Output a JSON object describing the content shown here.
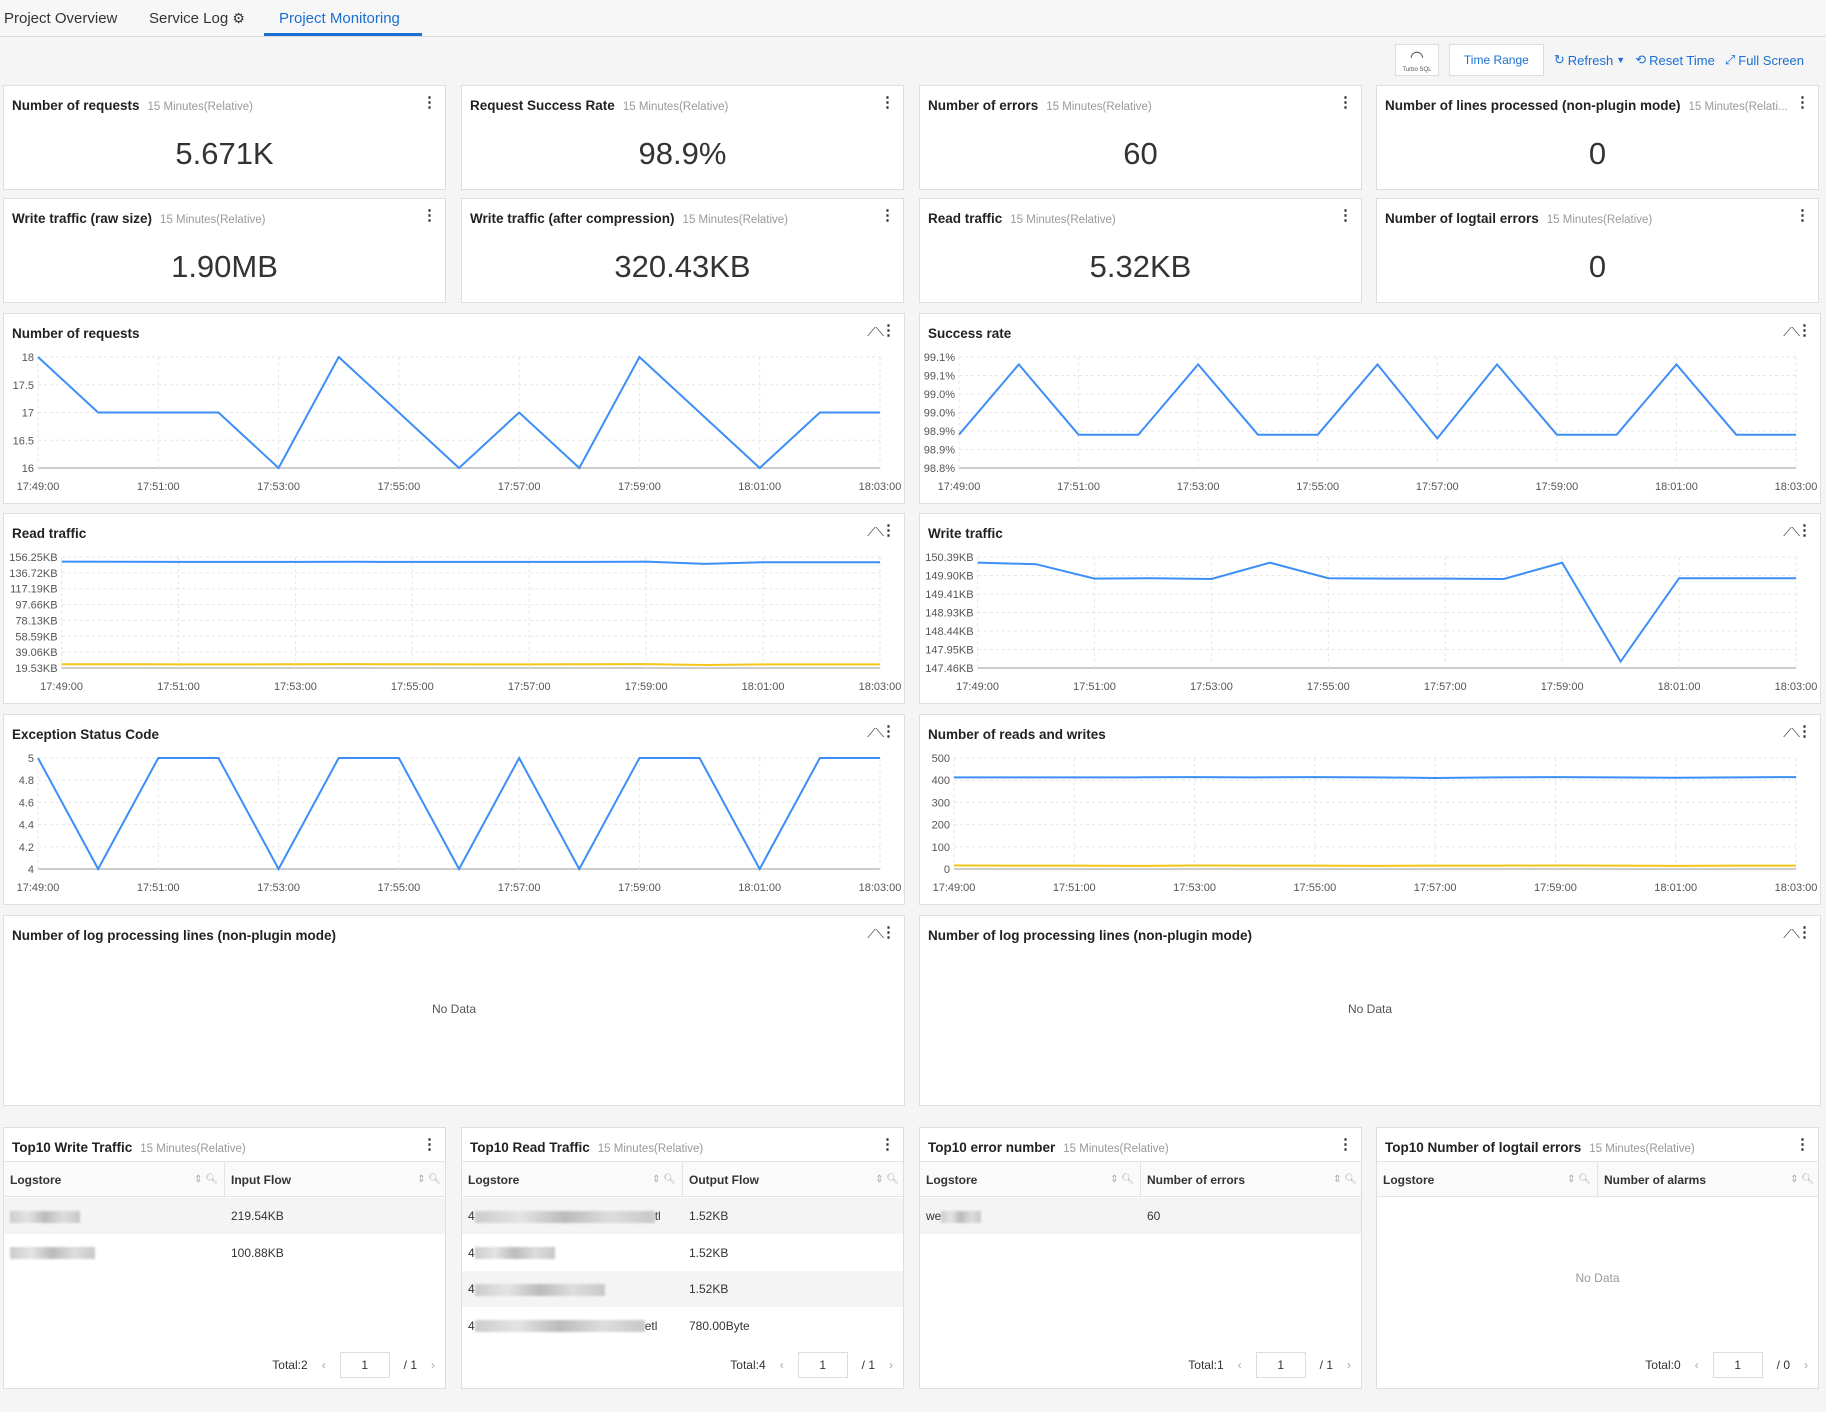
{
  "tabs": [
    {
      "label": "Project Overview"
    },
    {
      "label": "Service Log"
    },
    {
      "label": "Project Monitoring",
      "active": true
    }
  ],
  "toolbar": {
    "turbo_label": "Turbo SQL",
    "time_range": "Time Range",
    "refresh": "Refresh",
    "reset_time": "Reset Time",
    "full_screen": "Full Screen"
  },
  "colors": {
    "accent": "#1b6fd1",
    "series_blue": "#3d8ef7",
    "series_yellow": "#f5c518"
  },
  "stats": [
    {
      "title": "Number of requests",
      "range": "15 Minutes(Relative)",
      "value": "5.671K"
    },
    {
      "title": "Request Success Rate",
      "range": "15 Minutes(Relative)",
      "value": "98.9%"
    },
    {
      "title": "Number of errors",
      "range": "15 Minutes(Relative)",
      "value": "60"
    },
    {
      "title": "Number of lines processed (non-plugin mode)",
      "range": "15 Minutes(Relati...",
      "value": "0"
    },
    {
      "title": "Write traffic (raw size)",
      "range": "15 Minutes(Relative)",
      "value": "1.90MB"
    },
    {
      "title": "Write traffic (after compression)",
      "range": "15 Minutes(Relative)",
      "value": "320.43KB"
    },
    {
      "title": "Read traffic",
      "range": "15 Minutes(Relative)",
      "value": "5.32KB"
    },
    {
      "title": "Number of logtail errors",
      "range": "15 Minutes(Relative)",
      "value": "0"
    }
  ],
  "chart_data": [
    {
      "type": "line",
      "title": "Number of requests",
      "x": [
        "17:49:00",
        "17:50:00",
        "17:51:00",
        "17:52:00",
        "17:53:00",
        "17:54:00",
        "17:55:00",
        "17:56:00",
        "17:57:00",
        "17:58:00",
        "17:59:00",
        "18:00:00",
        "18:01:00",
        "18:02:00",
        "18:03:00"
      ],
      "xticks": [
        "17:49:00",
        "17:51:00",
        "17:53:00",
        "17:55:00",
        "17:57:00",
        "17:59:00",
        "18:01:00",
        "18:03:00"
      ],
      "ylim": [
        16,
        18
      ],
      "yticks": [
        "16",
        "16.5",
        "17",
        "17.5",
        "18"
      ],
      "grid": true,
      "series": [
        {
          "color": "#3d8ef7",
          "values": [
            18,
            17,
            17,
            17,
            16,
            18,
            17,
            16,
            17,
            16,
            18,
            17,
            16,
            17,
            17
          ]
        }
      ]
    },
    {
      "type": "line",
      "title": "Success rate",
      "x": [
        "17:49:00",
        "17:50:00",
        "17:51:00",
        "17:52:00",
        "17:53:00",
        "17:54:00",
        "17:55:00",
        "17:56:00",
        "17:57:00",
        "17:58:00",
        "17:59:00",
        "18:00:00",
        "18:01:00",
        "18:02:00",
        "18:03:00"
      ],
      "xticks": [
        "17:49:00",
        "17:51:00",
        "17:53:00",
        "17:55:00",
        "17:57:00",
        "17:59:00",
        "18:01:00",
        "18:03:00"
      ],
      "ylim": [
        98.8,
        99.1
      ],
      "yticks": [
        "98.8%",
        "98.9%",
        "98.9%",
        "99.0%",
        "99.0%",
        "99.1%",
        "99.1%"
      ],
      "grid": true,
      "series": [
        {
          "color": "#3d8ef7",
          "values": [
            98.89,
            99.08,
            98.89,
            98.89,
            99.08,
            98.89,
            98.89,
            99.08,
            98.88,
            99.08,
            98.89,
            98.89,
            99.08,
            98.89,
            98.89
          ]
        }
      ]
    },
    {
      "type": "line",
      "title": "Read traffic",
      "x": [
        "17:49:00",
        "17:50:00",
        "17:51:00",
        "17:52:00",
        "17:53:00",
        "17:54:00",
        "17:55:00",
        "17:56:00",
        "17:57:00",
        "17:58:00",
        "17:59:00",
        "18:00:00",
        "18:01:00",
        "18:02:00",
        "18:03:00"
      ],
      "xticks": [
        "17:49:00",
        "17:51:00",
        "17:53:00",
        "17:55:00",
        "17:57:00",
        "17:59:00",
        "18:01:00",
        "18:03:00"
      ],
      "ylim": [
        19.53,
        156.25
      ],
      "yticks": [
        "19.53KB",
        "39.06KB",
        "58.59KB",
        "78.13KB",
        "97.66KB",
        "117.19KB",
        "136.72KB",
        "156.25KB"
      ],
      "grid": true,
      "series": [
        {
          "color": "#3d8ef7",
          "values": [
            150.5,
            150.4,
            150.2,
            150.2,
            150.2,
            150.4,
            150.2,
            150.2,
            150.2,
            150.2,
            150.5,
            147.8,
            149.8,
            149.8,
            149.8
          ]
        },
        {
          "color": "#f5c518",
          "values": [
            24.1,
            24.1,
            24.0,
            24.0,
            24.1,
            24.3,
            24.1,
            24.0,
            24.0,
            24.1,
            24.3,
            23.2,
            24.0,
            24.0,
            24.0
          ]
        }
      ]
    },
    {
      "type": "line",
      "title": "Write traffic",
      "x": [
        "17:49:00",
        "17:50:00",
        "17:51:00",
        "17:52:00",
        "17:53:00",
        "17:54:00",
        "17:55:00",
        "17:56:00",
        "17:57:00",
        "17:58:00",
        "17:59:00",
        "18:00:00",
        "18:01:00",
        "18:02:00",
        "18:03:00"
      ],
      "xticks": [
        "17:49:00",
        "17:51:00",
        "17:53:00",
        "17:55:00",
        "17:57:00",
        "17:59:00",
        "18:01:00",
        "18:03:00"
      ],
      "ylim": [
        147.46,
        150.39
      ],
      "yticks": [
        "147.46KB",
        "147.95KB",
        "148.44KB",
        "148.93KB",
        "149.41KB",
        "149.90KB",
        "150.39KB"
      ],
      "grid": true,
      "series": [
        {
          "color": "#3d8ef7",
          "values": [
            150.24,
            150.2,
            149.82,
            149.83,
            149.81,
            150.24,
            149.83,
            149.82,
            149.82,
            149.81,
            150.24,
            147.63,
            149.83,
            149.83,
            149.83
          ]
        }
      ]
    },
    {
      "type": "line",
      "title": "Exception Status Code",
      "x": [
        "17:49:00",
        "17:50:00",
        "17:51:00",
        "17:52:00",
        "17:53:00",
        "17:54:00",
        "17:55:00",
        "17:56:00",
        "17:57:00",
        "17:58:00",
        "17:59:00",
        "18:00:00",
        "18:01:00",
        "18:02:00",
        "18:03:00"
      ],
      "xticks": [
        "17:49:00",
        "17:51:00",
        "17:53:00",
        "17:55:00",
        "17:57:00",
        "17:59:00",
        "18:01:00",
        "18:03:00"
      ],
      "ylim": [
        4,
        5
      ],
      "yticks": [
        "4",
        "4.2",
        "4.4",
        "4.6",
        "4.8",
        "5"
      ],
      "grid": true,
      "series": [
        {
          "color": "#3d8ef7",
          "values": [
            5,
            4,
            5,
            5,
            4,
            5,
            5,
            4,
            5,
            4,
            5,
            5,
            4,
            5,
            5
          ]
        }
      ]
    },
    {
      "type": "line",
      "title": "Number of reads and writes",
      "x": [
        "17:49:00",
        "17:50:00",
        "17:51:00",
        "17:52:00",
        "17:53:00",
        "17:54:00",
        "17:55:00",
        "17:56:00",
        "17:57:00",
        "17:58:00",
        "17:59:00",
        "18:00:00",
        "18:01:00",
        "18:02:00",
        "18:03:00"
      ],
      "xticks": [
        "17:49:00",
        "17:51:00",
        "17:53:00",
        "17:55:00",
        "17:57:00",
        "17:59:00",
        "18:01:00",
        "18:03:00"
      ],
      "ylim": [
        0,
        500
      ],
      "yticks": [
        "0",
        "100",
        "200",
        "300",
        "400",
        "500"
      ],
      "grid": true,
      "series": [
        {
          "color": "#3d8ef7",
          "values": [
            413,
            413,
            413,
            413,
            414,
            413,
            414,
            413,
            410,
            413,
            414,
            413,
            411,
            413,
            414
          ]
        },
        {
          "color": "#f5c518",
          "values": [
            16,
            15,
            15,
            14,
            16,
            15,
            15,
            14,
            15,
            15,
            16,
            15,
            14,
            15,
            15
          ]
        }
      ]
    }
  ],
  "nodata_panels": [
    {
      "title": "Number of log processing lines (non-plugin mode)",
      "text": "No Data"
    },
    {
      "title": "Number of log processing lines (non-plugin mode)",
      "text": "No Data"
    }
  ],
  "tables": [
    {
      "title": "Top10 Write Traffic",
      "range": "15 Minutes(Relative)",
      "columns": [
        "Logstore",
        "Input Flow"
      ],
      "rows": [
        {
          "prefix": "",
          "suffix": "",
          "value": "219.54KB"
        },
        {
          "prefix": "",
          "suffix": "",
          "value": "100.88KB"
        }
      ],
      "total": "Total:2",
      "page": "1",
      "pages": "/ 1"
    },
    {
      "title": "Top10 Read Traffic",
      "range": "15 Minutes(Relative)",
      "columns": [
        "Logstore",
        "Output Flow"
      ],
      "rows": [
        {
          "prefix": "4",
          "suffix": "tl",
          "value": "1.52KB"
        },
        {
          "prefix": "4",
          "suffix": "",
          "value": "1.52KB"
        },
        {
          "prefix": "4",
          "suffix": "",
          "value": "1.52KB"
        },
        {
          "prefix": "4",
          "suffix": "etl",
          "value": "780.00Byte"
        }
      ],
      "total": "Total:4",
      "page": "1",
      "pages": "/ 1"
    },
    {
      "title": "Top10 error number",
      "range": "15 Minutes(Relative)",
      "columns": [
        "Logstore",
        "Number of errors"
      ],
      "rows": [
        {
          "prefix": "we",
          "suffix": "",
          "value": "60"
        }
      ],
      "total": "Total:1",
      "page": "1",
      "pages": "/ 1"
    },
    {
      "title": "Top10 Number of logtail errors",
      "range": "15 Minutes(Relative)",
      "columns": [
        "Logstore",
        "Number of alarms"
      ],
      "rows": [],
      "empty": "No Data",
      "total": "Total:0",
      "page": "1",
      "pages": "/ 0"
    }
  ]
}
